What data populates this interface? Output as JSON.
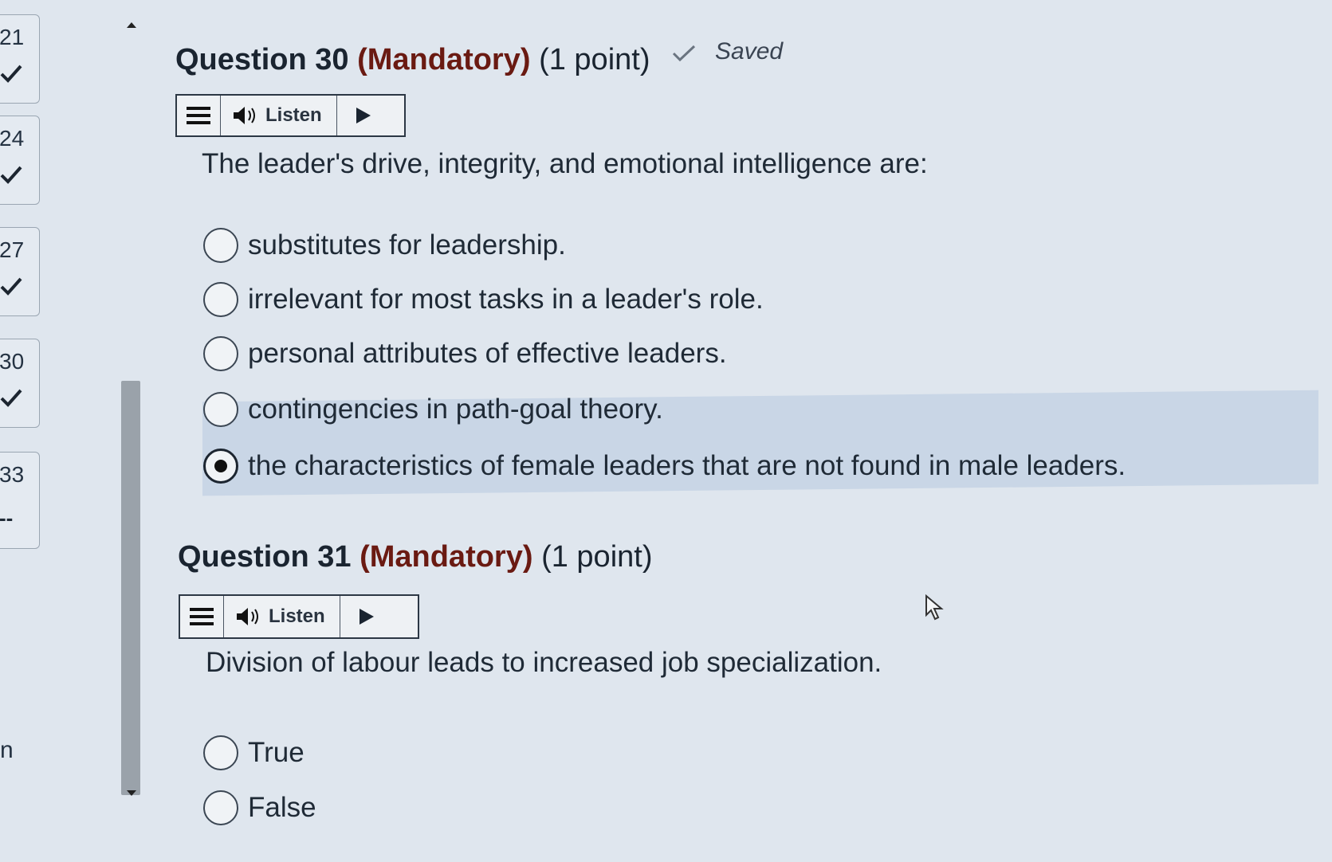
{
  "nav": [
    {
      "num": "21",
      "status": "check"
    },
    {
      "num": "24",
      "status": "check"
    },
    {
      "num": "27",
      "status": "check"
    },
    {
      "num": "30",
      "status": "check"
    },
    {
      "num": "33",
      "status": "dash",
      "status_text": "--"
    }
  ],
  "nav_footer_text": "n",
  "q30": {
    "title_prefix": "Question 30",
    "mandatory": "(Mandatory)",
    "points": "(1 point)",
    "saved": "Saved",
    "listen_label": "Listen",
    "text": "The leader's drive, integrity, and emotional intelligence are:",
    "options": [
      {
        "label": "substitutes for leadership.",
        "selected": false
      },
      {
        "label": "irrelevant for most tasks in a leader's role.",
        "selected": false
      },
      {
        "label": "personal attributes of effective leaders.",
        "selected": false
      },
      {
        "label": "contingencies in path-goal theory.",
        "selected": false
      },
      {
        "label": "the characteristics of female leaders that are not found in male leaders.",
        "selected": true
      }
    ]
  },
  "q31": {
    "title_prefix": "Question 31",
    "mandatory": "(Mandatory)",
    "points": "(1 point)",
    "listen_label": "Listen",
    "text": "Division of labour leads to increased job specialization.",
    "options": [
      {
        "label": "True",
        "selected": false
      },
      {
        "label": "False",
        "selected": false
      }
    ]
  },
  "colors": {
    "selected_option_bg": "#c9d6e6",
    "mandatory_text": "#6a1a12",
    "background": "#dfe6ee"
  }
}
